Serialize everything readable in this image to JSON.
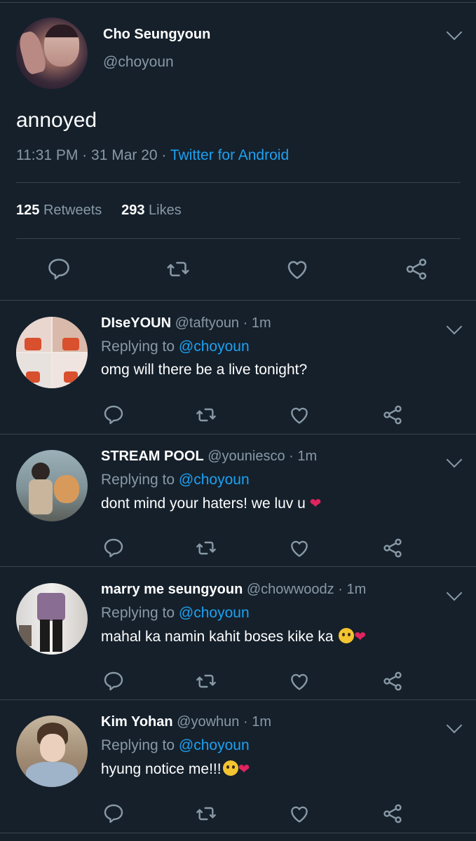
{
  "main_tweet": {
    "name": "Cho Seungyoun",
    "handle": "@choyoun",
    "text": "annoyed",
    "time": "11:31 PM",
    "date": "31 Mar 20",
    "source": "Twitter for Android",
    "retweet_count": "125",
    "retweet_label": "Retweets",
    "like_count": "293",
    "like_label": "Likes"
  },
  "replies": [
    {
      "name": "DIseYOUN",
      "handle": "@taftyoun",
      "time": "1m",
      "replying_prefix": "Replying to",
      "replying_to": "@choyoun",
      "text": "omg will there be a live tonight?"
    },
    {
      "name": "STREAM POOL",
      "handle": "@youniesco",
      "time": "1m",
      "replying_prefix": "Replying to",
      "replying_to": "@choyoun",
      "text": "dont mind your haters! we luv u"
    },
    {
      "name": "marry me seungyoun",
      "handle": "@chowwoodz",
      "time": "1m",
      "replying_prefix": "Replying to",
      "replying_to": "@choyoun",
      "text": "mahal ka namin kahit boses kike ka"
    },
    {
      "name": "Kim Yohan",
      "handle": "@yowhun",
      "time": "1m",
      "replying_prefix": "Replying to",
      "replying_to": "@choyoun",
      "text": "hyung notice me!!!"
    }
  ],
  "emoji": {
    "heart": "❤",
    "sep": "·"
  },
  "icons": [
    "reply-icon",
    "retweet-icon",
    "like-icon",
    "share-icon",
    "chevron-down-icon"
  ],
  "colors": {
    "background": "#15202b",
    "muted": "#8899a6",
    "accent": "#1da1f2",
    "divider": "#38444d"
  }
}
